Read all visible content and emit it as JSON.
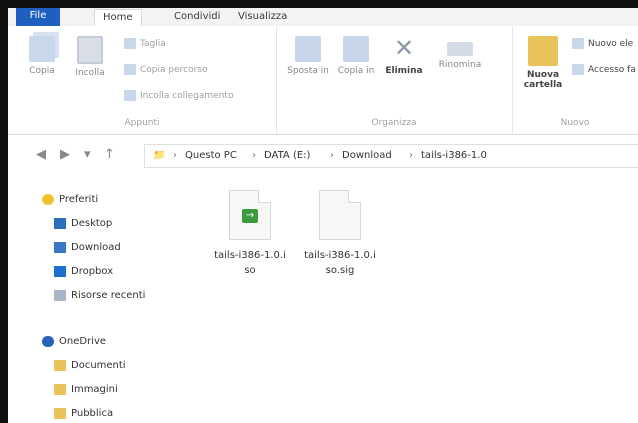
{
  "ribbon_tabs": [
    "File",
    "Home",
    "Condividi",
    "Visualizza"
  ],
  "groups": {
    "appunti": "Appunti",
    "organizza": "Organizza",
    "nuovo": "Nuovo"
  },
  "buttons": {
    "copia": "Copia",
    "incolla": "Incolla",
    "taglia": "Taglia",
    "copia_percorso": "Copia percorso",
    "incolla_collegamento": "Incolla collegamento",
    "sposta_in": "Sposta in",
    "copia_in": "Copia in",
    "elimina": "Elimina",
    "rinomina": "Rinomina",
    "nuova_cartella": "Nuova cartella",
    "nuovo_elemento": "Nuovo ele",
    "accesso_facilitato": "Accesso fa"
  },
  "breadcrumb": {
    "items": [
      "Questo PC",
      "DATA (E:)",
      "Download",
      "tails-i386-1.0"
    ],
    "separator": "›"
  },
  "sidebar": {
    "preferiti": "Preferiti",
    "desktop": "Desktop",
    "download": "Download",
    "dropbox": "Dropbox",
    "risorse_recenti": "Risorse recenti",
    "onedrive": "OneDrive",
    "documenti": "Documenti",
    "immagini": "Immagini",
    "pubblica": "Pubblica"
  },
  "files": [
    {
      "line1": "tails-i386-1.0.i",
      "line2": "so"
    },
    {
      "line1": "tails-i386-1.0.i",
      "line2": "so.sig"
    }
  ]
}
